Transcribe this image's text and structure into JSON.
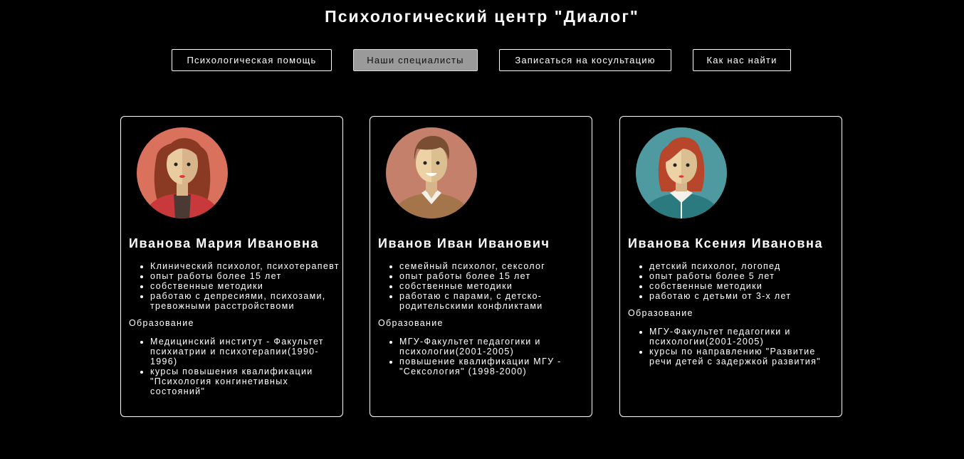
{
  "header": {
    "title": "Психологический центр \"Диалог\""
  },
  "nav": {
    "items": [
      {
        "label": "Психологическая помощь"
      },
      {
        "label": "Наши специалисты"
      },
      {
        "label": "Записаться на косультацию"
      },
      {
        "label": "Как нас найти"
      }
    ],
    "active_index": 1
  },
  "specialists": [
    {
      "name": "Иванова Мария Ивановна",
      "avatar_icon": "woman-avatar-curly-hair-icon",
      "skills": [
        "Клинический психолог, психотерапевт",
        "опыт работы более 15 лет",
        "собственные методики",
        "работаю с депресиями, психозами, тревожными расстройствоми"
      ],
      "education_label": "Образование",
      "education": [
        "Медицинский институт - Факультет психиатрии и психотерапии(1990-1996)",
        "курсы повышения квалификации \"Психология конгинетивных состояний\""
      ]
    },
    {
      "name": "Иванов Иван Иванович",
      "avatar_icon": "man-avatar-icon",
      "skills": [
        "семейный психолог, сексолог",
        "опыт работы более 15 лет",
        "собственные методики",
        "работаю с парами, с детско-родительскими конфликтами"
      ],
      "education_label": "Образование",
      "education": [
        "МГУ-Факультет педагогики и психологии(2001-2005)",
        "повышение квалификации МГУ - \"Сексология\" (1998-2000)"
      ]
    },
    {
      "name": "Иванова Ксения Ивановна",
      "avatar_icon": "woman-avatar-red-hair-icon",
      "skills": [
        "детский психолог, логопед",
        "опыт работы более 5 лет",
        "собственные методики",
        "работаю с детьми от 3-х лет"
      ],
      "education_label": "Образование",
      "education": [
        "МГУ-Факультет педагогики и психологии(2001-2005)",
        "курсы по направлению \"Развитие речи детей с задержкой развития\""
      ]
    }
  ]
}
